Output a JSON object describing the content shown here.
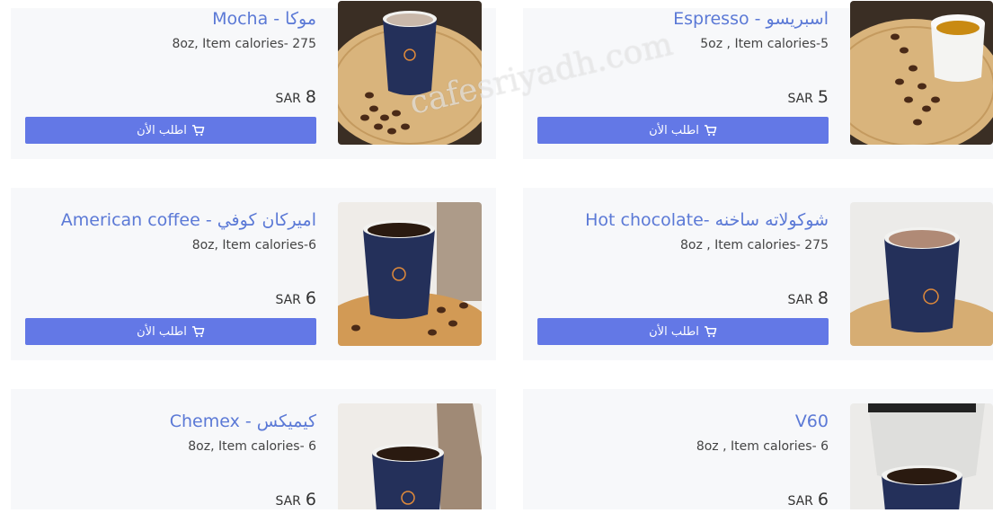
{
  "menu": {
    "items": [
      {
        "title": "Mocha - موكا",
        "desc": "8oz, Item calories- 275",
        "currency": "SAR",
        "price": "8",
        "order_label": "اطلب الأن"
      },
      {
        "title": "Espresso - اسبريسو",
        "desc": "5oz , Item calories-5",
        "currency": "SAR",
        "price": "5",
        "order_label": "اطلب الأن"
      },
      {
        "title": "American coffee - اميركان كوفي",
        "desc": "8oz, Item calories-6",
        "currency": "SAR",
        "price": "6",
        "order_label": "اطلب الأن"
      },
      {
        "title": "Hot chocolate- شوكولاته ساخنه",
        "desc": "8oz , Item calories- 275",
        "currency": "SAR",
        "price": "8",
        "order_label": "اطلب الأن"
      },
      {
        "title": "Chemex - كيميكس",
        "desc": "8oz, Item calories- 6",
        "currency": "SAR",
        "price": "6"
      },
      {
        "title": "V60",
        "desc": "8oz , Item calories- 6",
        "currency": "SAR",
        "price": "6"
      }
    ]
  },
  "watermark": "cafesriyadh.com",
  "colors": {
    "accent": "#6378e6",
    "title": "#5b79d6",
    "card_bg": "#f7f8fa",
    "cup": "#24305a"
  },
  "icons": {
    "order": "cart-icon"
  }
}
